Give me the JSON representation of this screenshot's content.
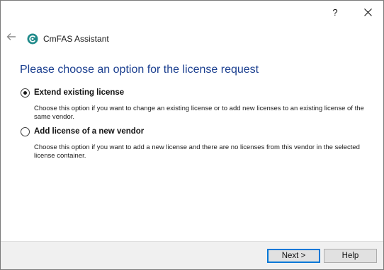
{
  "titlebar": {
    "help_label": "?",
    "close_icon": "close-icon"
  },
  "header": {
    "back_icon": "back-arrow-icon",
    "logo_icon": "cmfas-logo-icon",
    "app_title": "CmFAS Assistant"
  },
  "page": {
    "title": "Please choose an option for the license request"
  },
  "options": [
    {
      "label": "Extend existing license",
      "description": "Choose this option if you want to change an existing license or to add new licenses to an existing license of the same vendor.",
      "selected": true
    },
    {
      "label": "Add license of a new vendor",
      "description": "Choose this option if you want to add a new license and there are no licenses from this vendor in the selected license container.",
      "selected": false
    }
  ],
  "footer": {
    "next_label": "Next >",
    "help_label": "Help"
  },
  "colors": {
    "title_blue": "#1a3e8f",
    "logo_teal": "#1f8a8a",
    "focus_blue": "#0078d7"
  }
}
